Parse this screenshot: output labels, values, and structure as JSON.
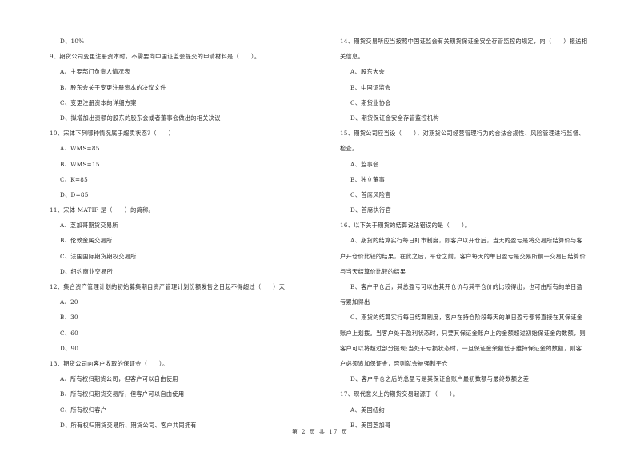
{
  "left_column": [
    {
      "type": "option",
      "text": "D、10%"
    },
    {
      "type": "question",
      "text": "9、期货公司变更注册资本时，不需要向中国证监会提交的申请材料是（　　）。"
    },
    {
      "type": "option",
      "text": "A、主要部门负责人情况表"
    },
    {
      "type": "option",
      "text": "B、股东会关于变更注册资本的决议文件"
    },
    {
      "type": "option",
      "text": "C、变更注册资本的详细方案"
    },
    {
      "type": "option",
      "text": "D、拟增加出资额的股东的股东会或者董事会做出的相关决议"
    },
    {
      "type": "question",
      "text": "10、宋体下列哪种情况属于超卖状态?（　　）"
    },
    {
      "type": "option",
      "text": "A、WMS=85"
    },
    {
      "type": "option",
      "text": "B、WMS=15"
    },
    {
      "type": "option",
      "text": "C、K=85"
    },
    {
      "type": "option",
      "text": "D、D=85"
    },
    {
      "type": "question",
      "text": "11、宋体 MATIF 是（　　）的简称。"
    },
    {
      "type": "option",
      "text": "A、芝加哥期货交易所"
    },
    {
      "type": "option",
      "text": "B、伦敦金属交易所"
    },
    {
      "type": "option",
      "text": "C、法国国际期货期权交易所"
    },
    {
      "type": "option",
      "text": "D、纽约商业交易所"
    },
    {
      "type": "question",
      "text": "12、集合资产管理计划的初始募集期自资产管理计划份额发售之日起不得超过（　　）天"
    },
    {
      "type": "option",
      "text": "A、20"
    },
    {
      "type": "option",
      "text": "B、30"
    },
    {
      "type": "option",
      "text": "C、60"
    },
    {
      "type": "option",
      "text": "D、90"
    },
    {
      "type": "question",
      "text": "13、期货公司向客户收取的保证金（　　）。"
    },
    {
      "type": "option",
      "text": "A、所有权归期货公司，但客户可以自由使用"
    },
    {
      "type": "option",
      "text": "B、所有权归期货交易所，但客户可以自由使用"
    },
    {
      "type": "option",
      "text": "C、所有权归客户"
    },
    {
      "type": "option",
      "text": "D、所有权归期货交易所、期货公司、客户共同拥有"
    }
  ],
  "right_column": [
    {
      "type": "question",
      "text": "14、期货交易所应当按照中国证监会有关期货保证金安全存管监控的规定，向（　　）报送相"
    },
    {
      "type": "question",
      "text": "关信息。"
    },
    {
      "type": "option",
      "text": "A、股东大会"
    },
    {
      "type": "option",
      "text": "B、中国证监会"
    },
    {
      "type": "option",
      "text": "C、期货业协会"
    },
    {
      "type": "option",
      "text": "D、期货保证金安全存管监控机构"
    },
    {
      "type": "question",
      "text": "15、期货公司应当设（　　），对期货公司经营管理行为的合法合规性、风险管理进行监督、"
    },
    {
      "type": "question",
      "text": "检查。"
    },
    {
      "type": "option",
      "text": "A、监事会"
    },
    {
      "type": "option",
      "text": "B、独立董事"
    },
    {
      "type": "option",
      "text": "C、首席风险官"
    },
    {
      "type": "option",
      "text": "D、首席执行官"
    },
    {
      "type": "question",
      "text": "16、以下关于期货的结算说法错误的是（　　）。"
    },
    {
      "type": "option",
      "text": "A、期货的结算实行每日盯市制度，即客户以开仓后，当天的盈亏是将交易所结算价与客"
    },
    {
      "type": "question",
      "text": "户开仓价比较的结果，在此之后，平仓之前，客户每天的单日盈亏是交易所前一交易日结算价"
    },
    {
      "type": "question",
      "text": "与当天结算价比较的结果"
    },
    {
      "type": "option",
      "text": "B、客户平仓后，其总盈亏可以由其开仓价与其平仓价的比较得出，也可由所有的单日盈"
    },
    {
      "type": "question",
      "text": "亏累加得出"
    },
    {
      "type": "option",
      "text": "C、期货的结算实行每日结算制度，客户在持仓阶段每天的单日盈亏都将直接在其保证金"
    },
    {
      "type": "question",
      "text": "账户上划拨。当客户处于盈利状态时，只要其保证金账户上的金额超过初始保证金的数额，则"
    },
    {
      "type": "question",
      "text": "客户可以将超过部分提现;当处于亏损状态时，一旦保证金余额低于维持保证金的数额，则客"
    },
    {
      "type": "question",
      "text": "户必须追加保证金，否则就会被强制平仓"
    },
    {
      "type": "option",
      "text": "D、客户平仓之后的总盈亏是其保证金账户最初数额与最终数额之差"
    },
    {
      "type": "question",
      "text": "17、现代意义上的期货交易起源于（　　）。"
    },
    {
      "type": "option",
      "text": "A、美国纽约"
    },
    {
      "type": "option",
      "text": "B、美国芝加哥"
    }
  ],
  "footer": {
    "page_label": "第 2 页 共 17 页"
  }
}
